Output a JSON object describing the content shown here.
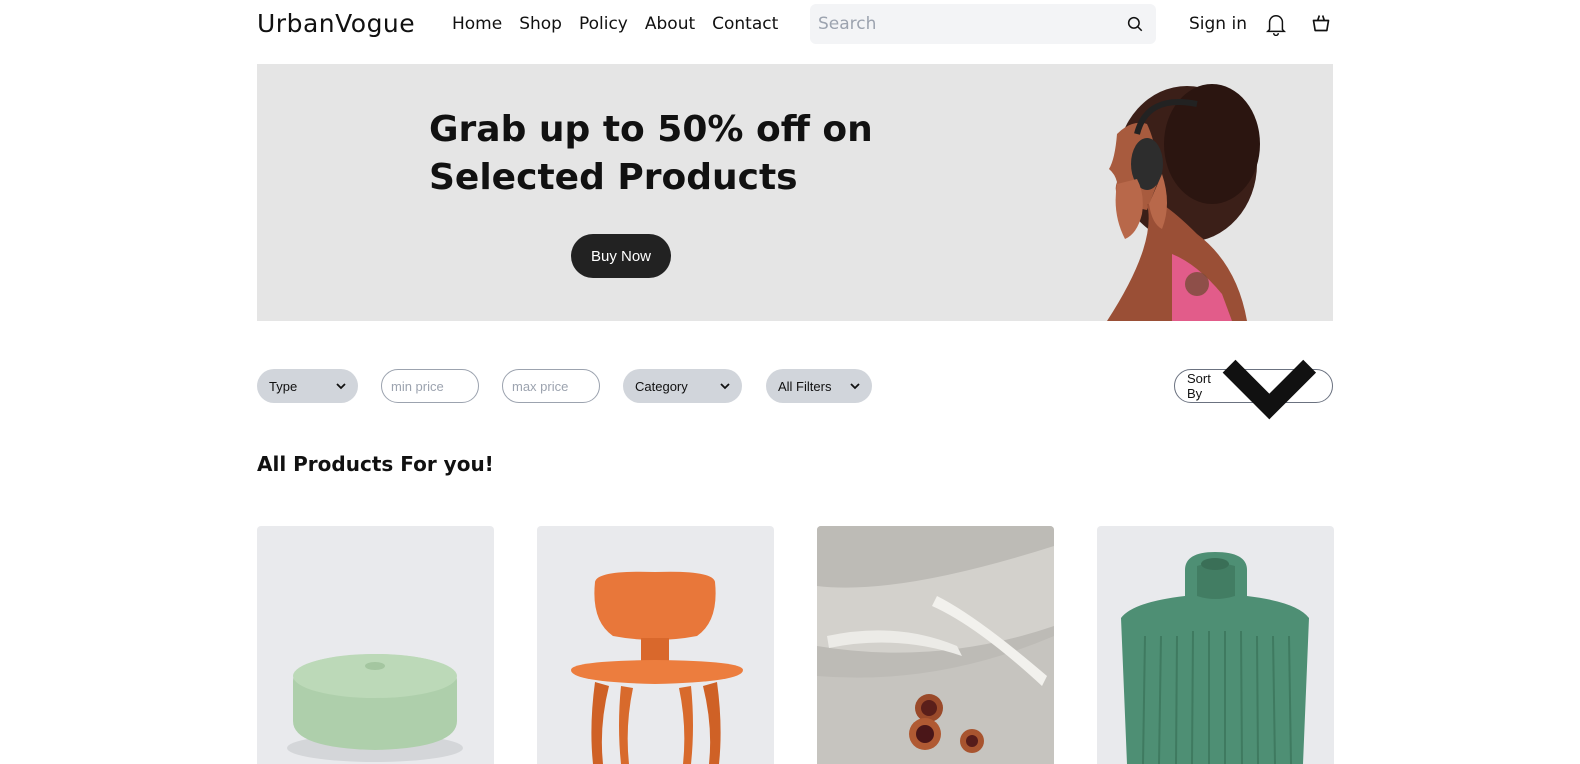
{
  "header": {
    "logo": "UrbanVogue",
    "nav": [
      "Home",
      "Shop",
      "Policy",
      "About",
      "Contact"
    ],
    "search_placeholder": "Search",
    "signin": "Sign in",
    "icons": [
      "search-icon",
      "bell-icon",
      "shopping-bag-icon"
    ]
  },
  "hero": {
    "title_line1": "Grab up to 50% off on",
    "title_line2": "Selected Products",
    "button": "Buy Now"
  },
  "filters": {
    "type": "Type",
    "min_price_placeholder": "min price",
    "max_price_placeholder": "max price",
    "category": "Category",
    "all_filters": "All Filters",
    "sort": "Sort By"
  },
  "section": {
    "title": "All Products For you!"
  },
  "colors": {
    "accent_dark": "#222222",
    "pill_bg": "#d1d5db",
    "hero_bg": "#e5e5e5",
    "card_bg": "#e9eaed"
  }
}
